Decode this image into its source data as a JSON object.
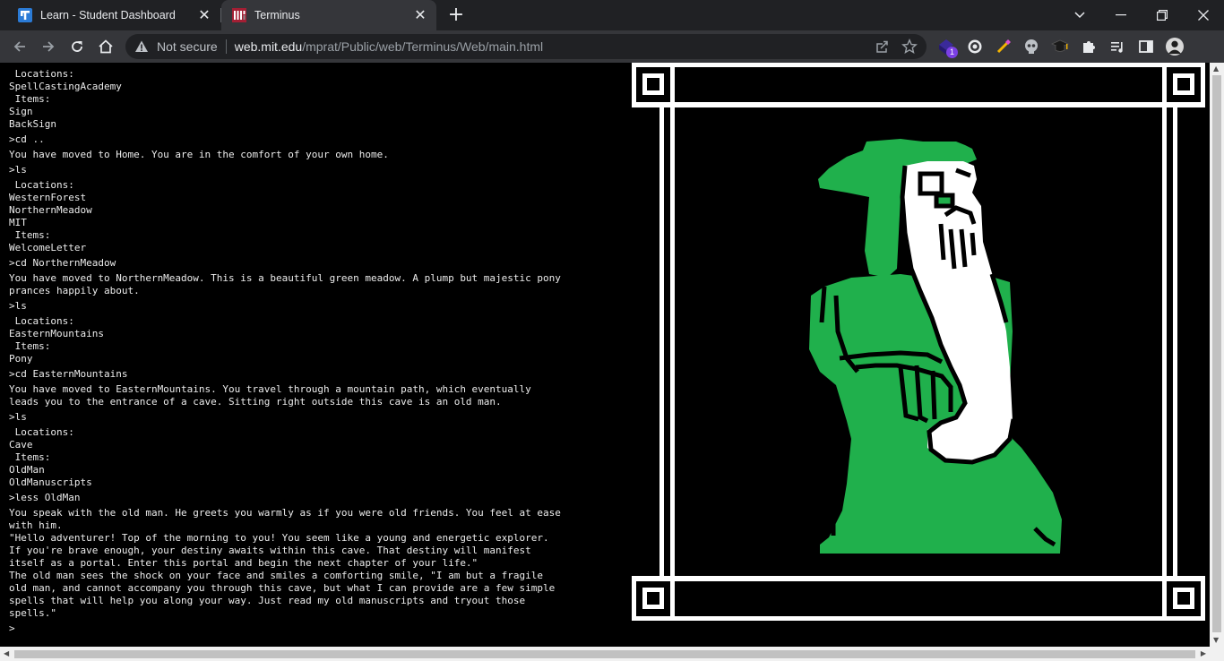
{
  "tabs": [
    {
      "title": "Learn - Student Dashboard",
      "favicon": "learn-favicon"
    },
    {
      "title": "Terminus",
      "favicon": "mit-favicon",
      "active": true
    }
  ],
  "toolbar": {
    "security_label": "Not secure",
    "url_host": "web.mit.edu",
    "url_path": "/mprat/Public/web/Terminus/Web/main.html",
    "extension_badge": "1"
  },
  "terminal": {
    "lines": [
      {
        "text": " Locations:"
      },
      {
        "text": "SpellCastingAcademy"
      },
      {
        "text": " Items:"
      },
      {
        "text": "Sign"
      },
      {
        "text": "BackSign"
      },
      {
        "text": ">cd ..",
        "cmd": true
      },
      {
        "text": "You have moved to Home. You are in the comfort of your own home."
      },
      {
        "text": ">ls",
        "cmd": true
      },
      {
        "text": " Locations:"
      },
      {
        "text": "WesternForest"
      },
      {
        "text": "NorthernMeadow"
      },
      {
        "text": "MIT"
      },
      {
        "text": " Items:"
      },
      {
        "text": "WelcomeLetter"
      },
      {
        "text": ">cd NorthernMeadow",
        "cmd": true
      },
      {
        "text": "You have moved to NorthernMeadow. This is a beautiful green meadow. A plump but majestic pony"
      },
      {
        "text": "prances happily about."
      },
      {
        "text": ">ls",
        "cmd": true
      },
      {
        "text": " Locations:"
      },
      {
        "text": "EasternMountains"
      },
      {
        "text": " Items:"
      },
      {
        "text": "Pony"
      },
      {
        "text": ">cd EasternMountains",
        "cmd": true
      },
      {
        "text": "You have moved to EasternMountains. You travel through a mountain path, which eventually"
      },
      {
        "text": "leads you to the entrance of a cave. Sitting right outside this cave is an old man."
      },
      {
        "text": ">ls",
        "cmd": true
      },
      {
        "text": " Locations:"
      },
      {
        "text": "Cave"
      },
      {
        "text": " Items:"
      },
      {
        "text": "OldMan"
      },
      {
        "text": "OldManuscripts"
      },
      {
        "text": ">less OldMan",
        "cmd": true
      },
      {
        "text": "You speak with the old man. He greets you warmly as if you were old friends. You feel at ease"
      },
      {
        "text": "with him."
      },
      {
        "text": "\"Hello adventurer! Top of the morning to you! You seem like a young and energetic explorer."
      },
      {
        "text": "If you're brave enough, your destiny awaits within this cave. That destiny will manifest"
      },
      {
        "text": "itself as a portal. Enter this portal and begin the next chapter of your life.\""
      },
      {
        "text": "The old man sees the shock on your face and smiles a comforting smile, \"I am but a fragile"
      },
      {
        "text": "old man, and cannot accompany you through this cave, but what I can provide are a few simple"
      },
      {
        "text": "spells that will help you along your way. Just read my old manuscripts and tryout those"
      },
      {
        "text": "spells.\""
      }
    ],
    "prompt": ">",
    "input_value": ""
  },
  "colors": {
    "wizard_robe": "#20b04c",
    "background": "#000000",
    "text": "#ececec",
    "frame": "#ffffff"
  }
}
